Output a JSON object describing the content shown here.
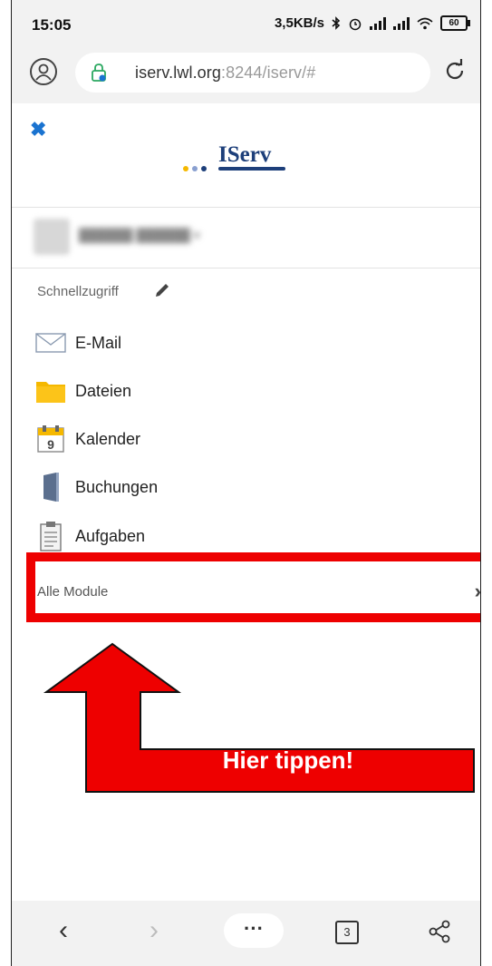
{
  "status": {
    "time": "15:05",
    "network_speed": "3,5KB/s",
    "battery": "60",
    "icons": [
      "bluetooth-icon",
      "alarm-icon",
      "signal-icon",
      "signal-icon",
      "wifi-icon",
      "battery-icon"
    ]
  },
  "browser": {
    "url_host": "iserv.lwl.org",
    "url_rest": ":8244/iserv/#",
    "tab_count": "3",
    "more_label": "···"
  },
  "drawer": {
    "logo_text": "IServ",
    "section_title": "Schnellzugriff",
    "items": [
      {
        "label": "E-Mail",
        "icon": "mail-icon"
      },
      {
        "label": "Dateien",
        "icon": "folder-icon"
      },
      {
        "label": "Kalender",
        "icon": "calendar-icon"
      },
      {
        "label": "Buchungen",
        "icon": "door-icon"
      },
      {
        "label": "Aufgaben",
        "icon": "clipboard-icon"
      }
    ],
    "calendar_day": "9",
    "all_modules_label": "Alle Module",
    "chevron": "›"
  },
  "annotation": {
    "text": "Hier tippen!",
    "color": "#ee0000"
  },
  "colors": {
    "accent_blue": "#1a73d0",
    "logo_navy": "#1d3f7a",
    "folder_yellow": "#f5b800"
  }
}
